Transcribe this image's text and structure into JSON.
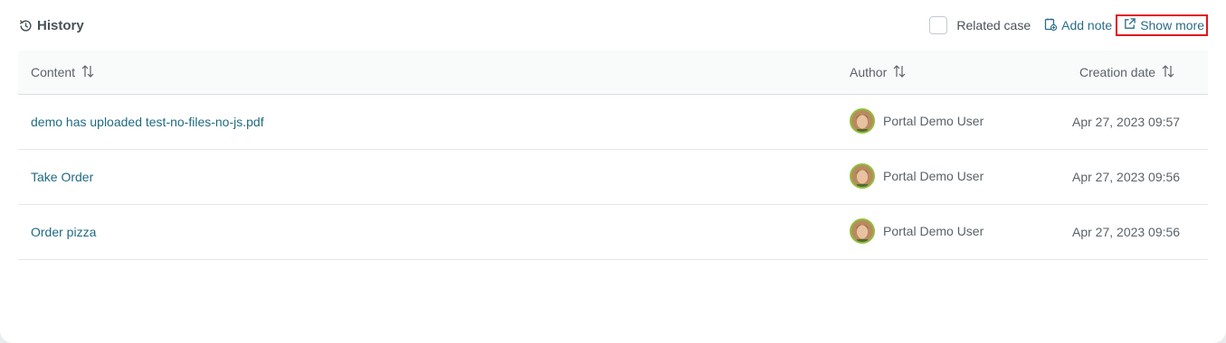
{
  "header": {
    "title": "History",
    "related_case_label": "Related case",
    "add_note_label": "Add note",
    "show_more_label": "Show more"
  },
  "table": {
    "columns": [
      "Content",
      "Author",
      "Creation date"
    ],
    "rows": [
      {
        "content": "demo has uploaded test-no-files-no-js.pdf",
        "author": "Portal Demo User",
        "date": "Apr 27, 2023 09:57"
      },
      {
        "content": "Take Order",
        "author": "Portal Demo User",
        "date": "Apr 27, 2023 09:56"
      },
      {
        "content": "Order pizza",
        "author": "Portal Demo User",
        "date": "Apr 27, 2023 09:56"
      }
    ]
  },
  "colors": {
    "link": "#1f6a83",
    "highlight": "#e1141c",
    "avatar_ring": "#8fbf3a"
  }
}
